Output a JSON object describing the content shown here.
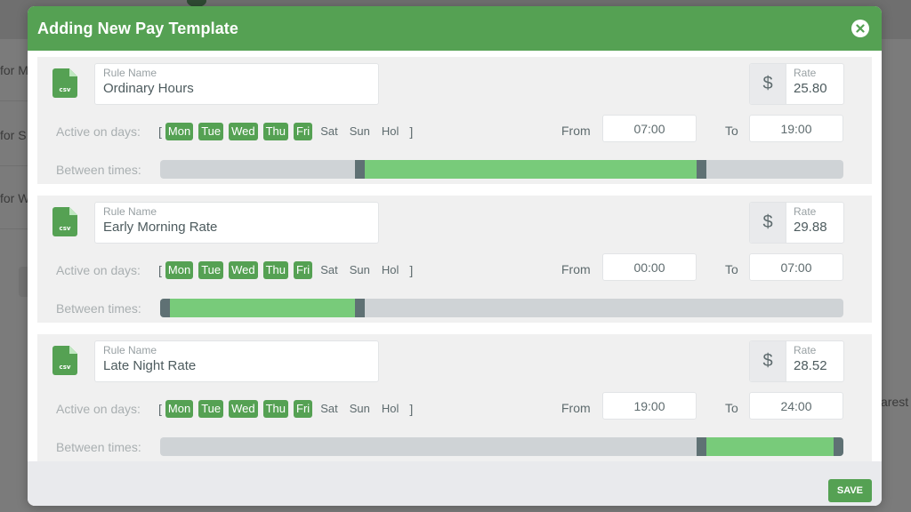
{
  "background": {
    "rows": [
      "for M",
      "for S",
      "for W"
    ],
    "right_text": "arest"
  },
  "modal": {
    "title": "Adding New Pay Template",
    "close_icon": "close-circle-icon",
    "save_label": "SAVE",
    "accent_color": "#55a153",
    "rules": [
      {
        "icon": "csv-file-icon",
        "icon_text": "csv",
        "name_label": "Rule Name",
        "name_value": "Ordinary Hours",
        "rate_symbol": "$",
        "rate_label": "Rate",
        "rate_value": "25.80",
        "days_label": "Active on days:",
        "bracket_open": "[",
        "bracket_close": "]",
        "days": [
          {
            "label": "Mon",
            "active": true
          },
          {
            "label": "Tue",
            "active": true
          },
          {
            "label": "Wed",
            "active": true
          },
          {
            "label": "Thu",
            "active": true
          },
          {
            "label": "Fri",
            "active": true
          },
          {
            "label": "Sat",
            "active": false
          },
          {
            "label": "Sun",
            "active": false
          },
          {
            "label": "Hol",
            "active": false
          }
        ],
        "from_label": "From",
        "from_value": "07:00",
        "to_label": "To",
        "to_value": "19:00",
        "times_label": "Between times:",
        "range_start_hours": 7,
        "range_end_hours": 19,
        "range_max_hours": 24
      },
      {
        "icon": "csv-file-icon",
        "icon_text": "csv",
        "name_label": "Rule Name",
        "name_value": "Early Morning Rate",
        "rate_symbol": "$",
        "rate_label": "Rate",
        "rate_value": "29.88",
        "days_label": "Active on days:",
        "bracket_open": "[",
        "bracket_close": "]",
        "days": [
          {
            "label": "Mon",
            "active": true
          },
          {
            "label": "Tue",
            "active": true
          },
          {
            "label": "Wed",
            "active": true
          },
          {
            "label": "Thu",
            "active": true
          },
          {
            "label": "Fri",
            "active": true
          },
          {
            "label": "Sat",
            "active": false
          },
          {
            "label": "Sun",
            "active": false
          },
          {
            "label": "Hol",
            "active": false
          }
        ],
        "from_label": "From",
        "from_value": "00:00",
        "to_label": "To",
        "to_value": "07:00",
        "times_label": "Between times:",
        "range_start_hours": 0,
        "range_end_hours": 7,
        "range_max_hours": 24
      },
      {
        "icon": "csv-file-icon",
        "icon_text": "csv",
        "name_label": "Rule Name",
        "name_value": "Late Night Rate",
        "rate_symbol": "$",
        "rate_label": "Rate",
        "rate_value": "28.52",
        "days_label": "Active on days:",
        "bracket_open": "[",
        "bracket_close": "]",
        "days": [
          {
            "label": "Mon",
            "active": true
          },
          {
            "label": "Tue",
            "active": true
          },
          {
            "label": "Wed",
            "active": true
          },
          {
            "label": "Thu",
            "active": true
          },
          {
            "label": "Fri",
            "active": true
          },
          {
            "label": "Sat",
            "active": false
          },
          {
            "label": "Sun",
            "active": false
          },
          {
            "label": "Hol",
            "active": false
          }
        ],
        "from_label": "From",
        "from_value": "19:00",
        "to_label": "To",
        "to_value": "24:00",
        "times_label": "Between times:",
        "range_start_hours": 19,
        "range_end_hours": 24,
        "range_max_hours": 24
      }
    ]
  }
}
